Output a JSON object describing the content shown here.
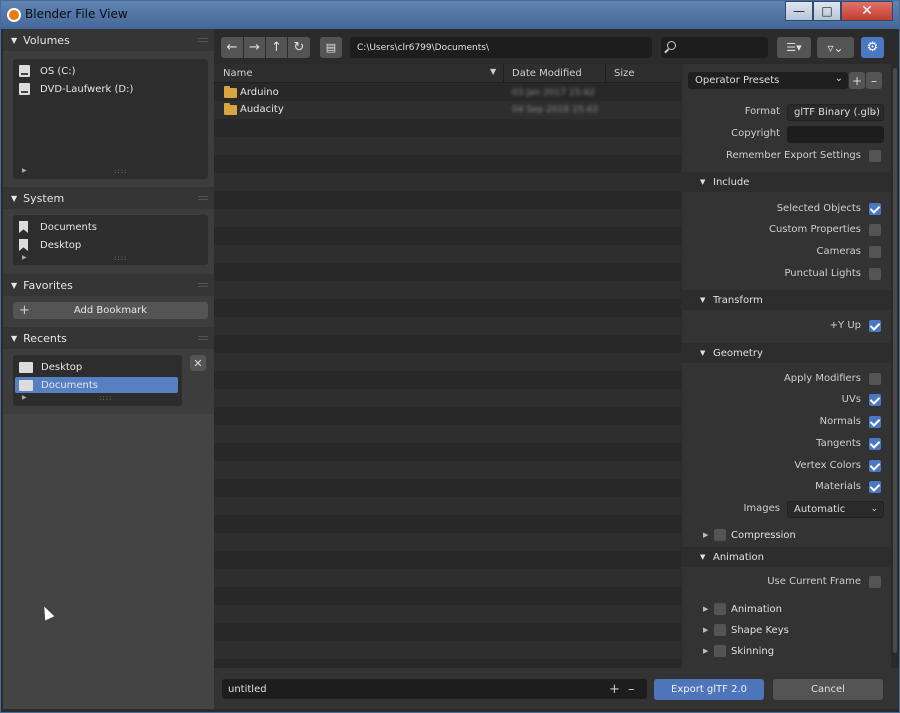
{
  "window": {
    "title": "Blender File View"
  },
  "sidebar": {
    "volumes": {
      "label": "Volumes",
      "items": [
        "OS (C:)",
        "DVD-Laufwerk (D:)"
      ]
    },
    "system": {
      "label": "System",
      "items": [
        "Documents",
        "Desktop"
      ]
    },
    "favorites": {
      "label": "Favorites",
      "add_label": "Add Bookmark"
    },
    "recents": {
      "label": "Recents",
      "items": [
        "Desktop",
        "Documents"
      ],
      "selected": "Documents"
    }
  },
  "toolbar": {
    "path": "C:\\Users\\clr6799\\Documents\\",
    "search_placeholder": ""
  },
  "filelist": {
    "columns": [
      "Name",
      "Date Modified",
      "Size"
    ],
    "rows": [
      {
        "name": "Arduino",
        "date": "03 Jan 2017 15:42",
        "size": ""
      },
      {
        "name": "Audacity",
        "date": "04 Sep 2018 15:43",
        "size": ""
      }
    ]
  },
  "panel": {
    "presets_label": "Operator Presets",
    "format_label": "Format",
    "format_value": "glTF Binary (.glb)",
    "copyright_label": "Copyright",
    "copyright_value": "",
    "remember_label": "Remember Export Settings",
    "remember": false,
    "include": {
      "label": "Include",
      "selected_objects": "Selected Objects",
      "custom_properties": "Custom Properties",
      "cameras": "Cameras",
      "punctual_lights": "Punctual Lights"
    },
    "transform": {
      "label": "Transform",
      "y_up": "+Y Up"
    },
    "geometry": {
      "label": "Geometry",
      "apply_modifiers": "Apply Modifiers",
      "uvs": "UVs",
      "normals": "Normals",
      "tangents": "Tangents",
      "vertex_colors": "Vertex Colors",
      "materials": "Materials",
      "images_label": "Images",
      "images_value": "Automatic"
    },
    "compression_label": "Compression",
    "animation": {
      "label": "Animation",
      "use_current_frame": "Use Current Frame",
      "sub_animation": "Animation",
      "shape_keys": "Shape Keys",
      "skinning": "Skinning"
    }
  },
  "bottom": {
    "filename": "untitled",
    "export_label": "Export glTF 2.0",
    "cancel_label": "Cancel"
  },
  "colors": {
    "accent": "#4e75b9",
    "folder": "#d9a53e",
    "titlebar": "#5f83b3"
  }
}
